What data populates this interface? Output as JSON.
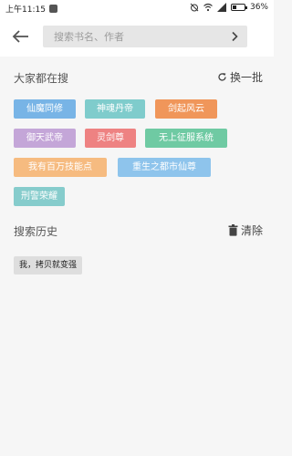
{
  "status_bar": {
    "time": "上午11:15",
    "battery_text": "36%",
    "battery_level": 0.36
  },
  "search": {
    "placeholder": "搜索书名、作者",
    "value": ""
  },
  "hot": {
    "title": "大家都在搜",
    "refresh_label": "换一批",
    "tags": [
      {
        "label": "仙魔同修",
        "color": "#78b4e6"
      },
      {
        "label": "神魂丹帝",
        "color": "#7fcccc"
      },
      {
        "label": "剑起风云",
        "color": "#f0965a"
      },
      {
        "label": "御天武帝",
        "color": "#c4a6d8"
      },
      {
        "label": "灵剑尊",
        "color": "#ee8282"
      },
      {
        "label": "无上征服系统",
        "color": "#6fcaa3"
      },
      {
        "label": "我有百万技能点",
        "color": "#f6bb80"
      },
      {
        "label": "重生之都市仙尊",
        "color": "#8ec4ec"
      },
      {
        "label": "刑警荣耀",
        "color": "#86cccc"
      }
    ]
  },
  "history": {
    "title": "搜索历史",
    "clear_label": "清除",
    "items": [
      "我，拷贝就变强"
    ]
  }
}
